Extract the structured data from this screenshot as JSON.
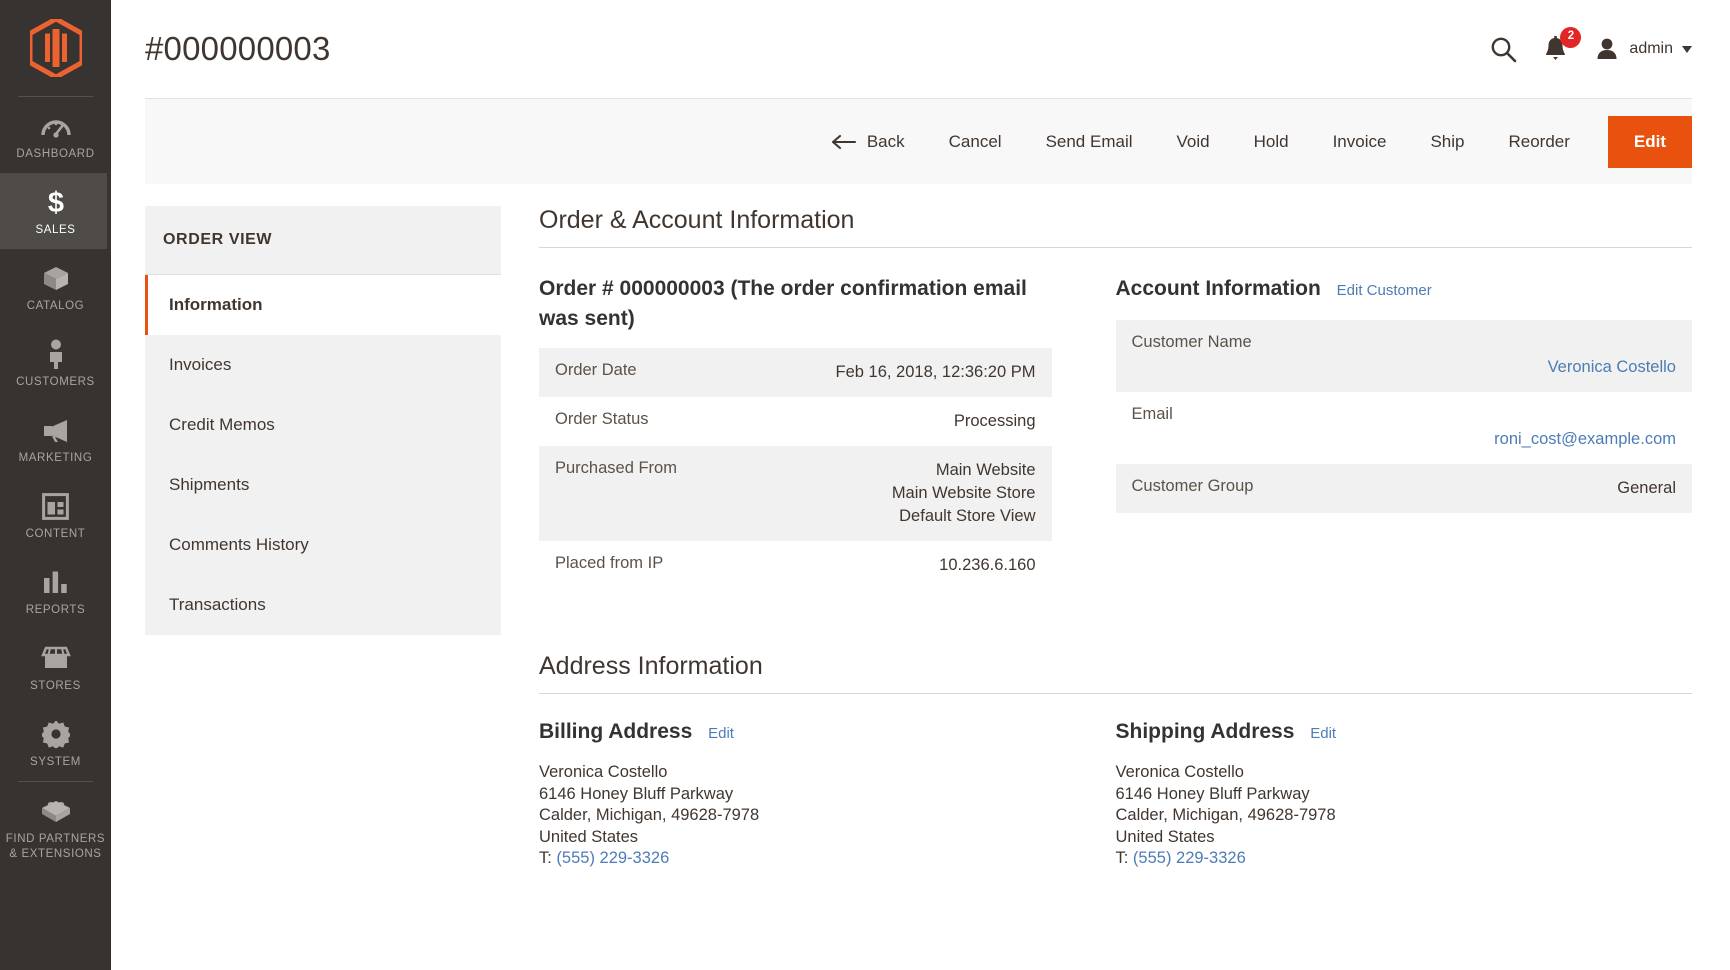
{
  "brand": {
    "accent": "#e8520e",
    "sidebar_bg": "#373330",
    "link": "#4c7cb5"
  },
  "sidebar": {
    "logo_name": "magento-logo",
    "items": [
      {
        "label": "DASHBOARD",
        "icon": "dashboard-gauge-icon",
        "active": false
      },
      {
        "label": "SALES",
        "icon": "dollar-sign-icon",
        "active": true
      },
      {
        "label": "CATALOG",
        "icon": "box-icon",
        "active": false
      },
      {
        "label": "CUSTOMERS",
        "icon": "person-icon",
        "active": false
      },
      {
        "label": "MARKETING",
        "icon": "megaphone-icon",
        "active": false
      },
      {
        "label": "CONTENT",
        "icon": "layout-page-icon",
        "active": false
      },
      {
        "label": "REPORTS",
        "icon": "bar-chart-icon",
        "active": false
      },
      {
        "label": "STORES",
        "icon": "storefront-icon",
        "active": false
      },
      {
        "label": "SYSTEM",
        "icon": "gear-icon",
        "active": false
      },
      {
        "label": "FIND PARTNERS\n& EXTENSIONS",
        "icon": "lego-brick-icon",
        "active": false
      }
    ]
  },
  "header": {
    "title": "#000000003",
    "search_icon": "search-icon",
    "notifications_icon": "bell-icon",
    "notifications_count": "2",
    "user_icon": "user-avatar-icon",
    "user_name": "admin",
    "caret_icon": "chevron-down-icon"
  },
  "toolbar": {
    "back": "Back",
    "cancel": "Cancel",
    "send_email": "Send Email",
    "void": "Void",
    "hold": "Hold",
    "invoice": "Invoice",
    "ship": "Ship",
    "reorder": "Reorder",
    "edit": "Edit"
  },
  "order_view": {
    "heading": "ORDER VIEW",
    "items": [
      {
        "label": "Information",
        "active": true
      },
      {
        "label": "Invoices",
        "active": false
      },
      {
        "label": "Credit Memos",
        "active": false
      },
      {
        "label": "Shipments",
        "active": false
      },
      {
        "label": "Comments History",
        "active": false
      },
      {
        "label": "Transactions",
        "active": false
      }
    ]
  },
  "order_account_section": {
    "heading": "Order & Account Information",
    "order_block": {
      "title": "Order # 000000003 (The order confirmation email was sent)",
      "rows": [
        {
          "key": "Order Date",
          "value": "Feb 16, 2018, 12:36:20 PM"
        },
        {
          "key": "Order Status",
          "value": "Processing"
        },
        {
          "key": "Purchased From",
          "value": "Main Website\nMain Website Store\nDefault Store View"
        },
        {
          "key": "Placed from IP",
          "value": "10.236.6.160"
        }
      ]
    },
    "account_block": {
      "title": "Account Information",
      "edit_link": "Edit Customer",
      "rows": [
        {
          "key": "Customer Name",
          "value": "Veronica Costello",
          "is_link": true
        },
        {
          "key": "Email",
          "value": "roni_cost@example.com",
          "is_link": true
        },
        {
          "key": "Customer Group",
          "value": "General",
          "is_link": false
        }
      ]
    }
  },
  "address_section": {
    "heading": "Address Information",
    "billing": {
      "title": "Billing Address",
      "edit_link": "Edit",
      "name": "Veronica Costello",
      "street": "6146 Honey Bluff Parkway",
      "city_state_zip": "Calder, Michigan, 49628-7978",
      "country": "United States",
      "phone_prefix": "T: ",
      "phone": "(555) 229-3326"
    },
    "shipping": {
      "title": "Shipping Address",
      "edit_link": "Edit",
      "name": "Veronica Costello",
      "street": "6146 Honey Bluff Parkway",
      "city_state_zip": "Calder, Michigan, 49628-7978",
      "country": "United States",
      "phone_prefix": "T: ",
      "phone": "(555) 229-3326"
    }
  }
}
